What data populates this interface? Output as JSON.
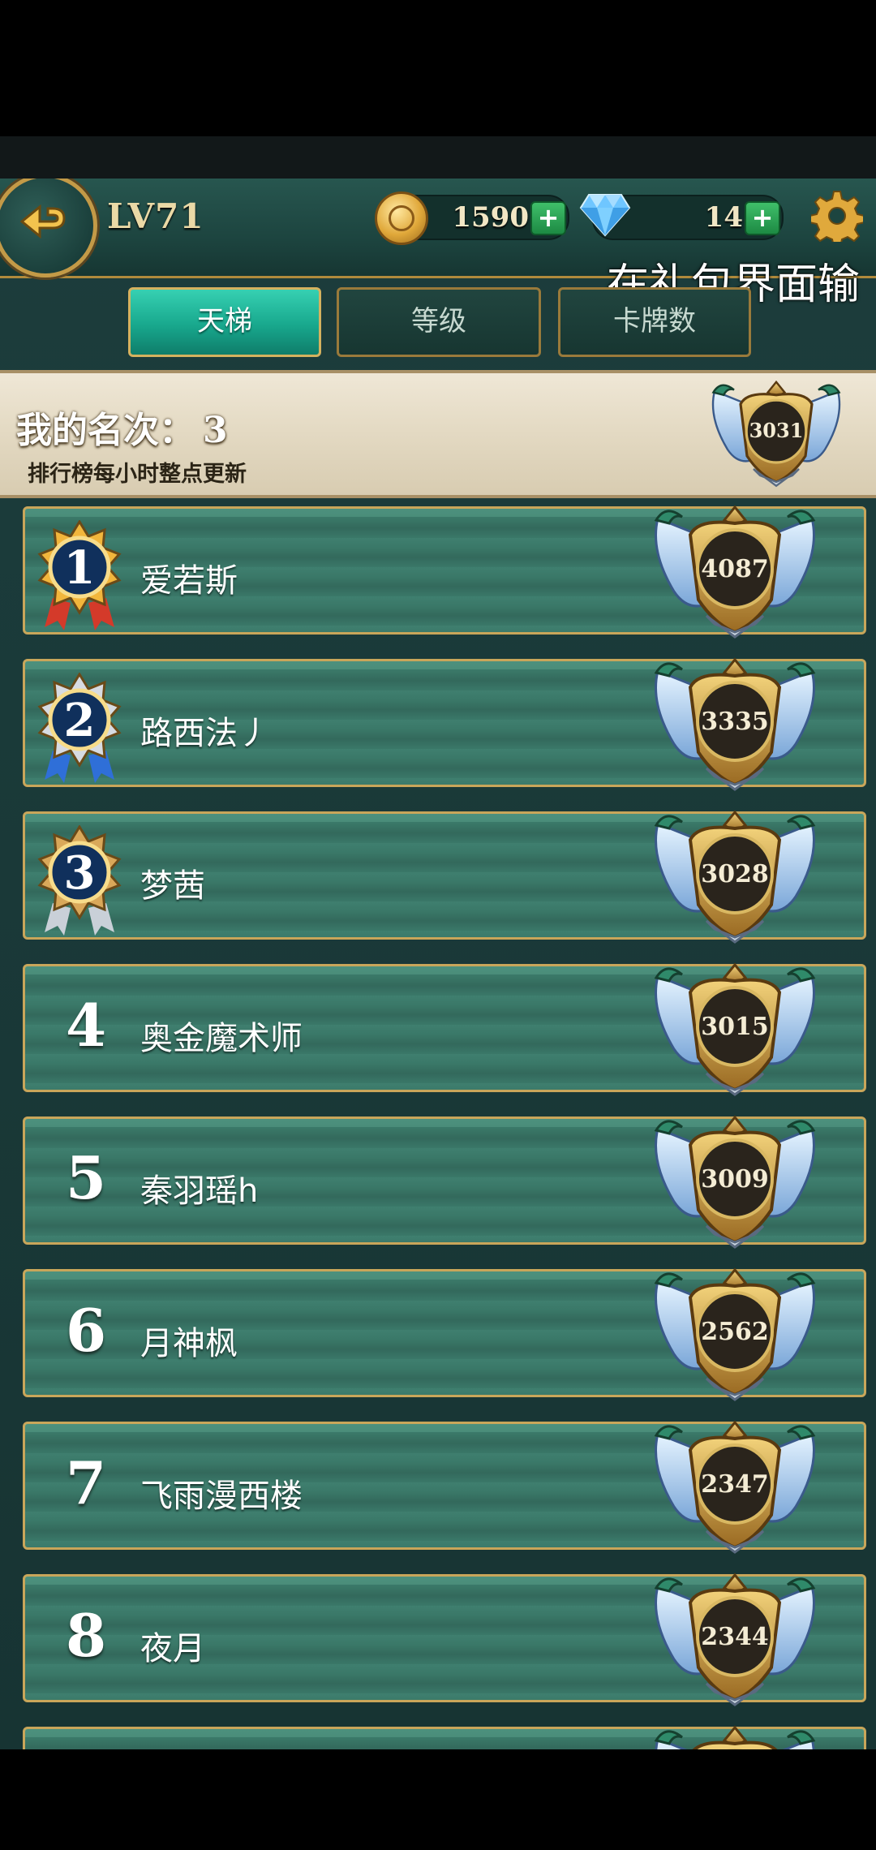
{
  "header": {
    "level": "LV71",
    "gold": "1590",
    "gems": "14",
    "overlay_caption": "在礼包界面输"
  },
  "tabs": [
    {
      "label": "天梯",
      "active": true
    },
    {
      "label": "等级",
      "active": false
    },
    {
      "label": "卡牌数",
      "active": false
    }
  ],
  "my_rank": {
    "label": "我的名次：",
    "rank": "3",
    "note": "排行榜每小时整点更新",
    "score": "3031"
  },
  "leaderboard": [
    {
      "rank": "1",
      "name": "爱若斯",
      "score": "4087",
      "medal": "gold"
    },
    {
      "rank": "2",
      "name": "路西法丿",
      "score": "3335",
      "medal": "silver"
    },
    {
      "rank": "3",
      "name": "梦茜",
      "score": "3028",
      "medal": "bronze"
    },
    {
      "rank": "4",
      "name": "奥金魔术师",
      "score": "3015"
    },
    {
      "rank": "5",
      "name": "秦羽瑶h",
      "score": "3009"
    },
    {
      "rank": "6",
      "name": "月神枫",
      "score": "2562"
    },
    {
      "rank": "7",
      "name": "飞雨漫西楼",
      "score": "2347"
    },
    {
      "rank": "8",
      "name": "夜月",
      "score": "2344"
    },
    {
      "rank": "",
      "name": "",
      "score": ""
    }
  ],
  "icons": {
    "back": "back-arrow-icon",
    "coin": "gold-coin-icon",
    "gem": "diamond-icon",
    "settings": "gear-icon"
  },
  "colors": {
    "tab_active": "#18a88d",
    "row_bg": "#3a7868",
    "gold_trim": "#c9a65a"
  }
}
